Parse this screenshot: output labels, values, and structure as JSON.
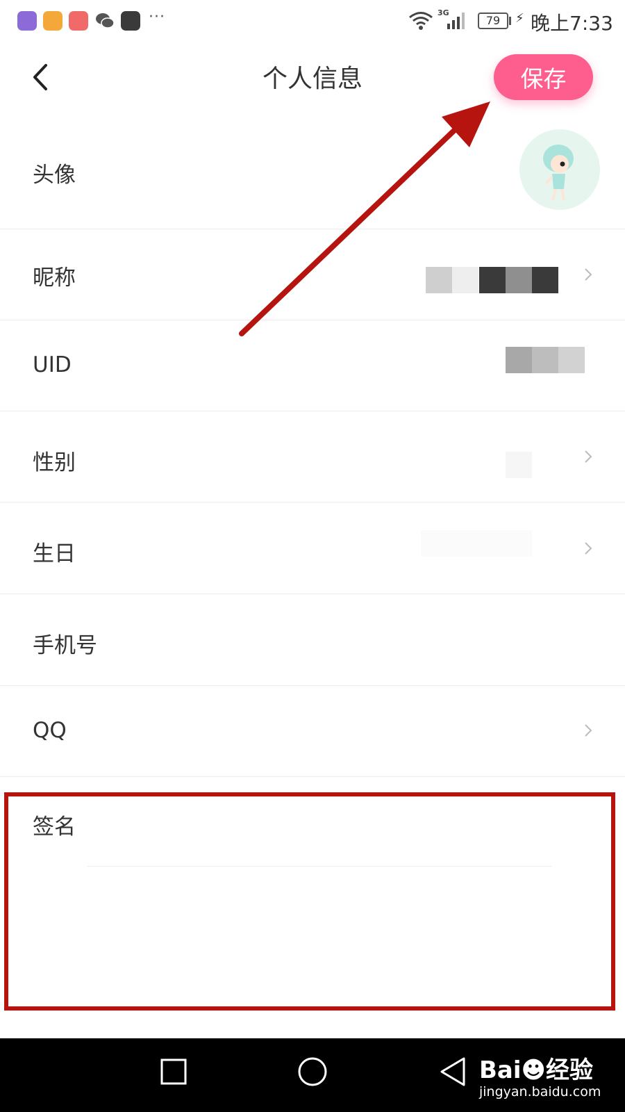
{
  "status_bar": {
    "app_icons": [
      {
        "name": "app-icon-1",
        "color": "#8c6ad8"
      },
      {
        "name": "app-icon-2",
        "color": "#f5a83a"
      },
      {
        "name": "app-icon-3",
        "color": "#f06a6a"
      },
      {
        "name": "wechat-icon",
        "color": "#555555"
      },
      {
        "name": "huawei-store-icon",
        "color": "#3a3a3a"
      }
    ],
    "more": "···",
    "network": "3G",
    "battery": "79",
    "time": "晚上7:33"
  },
  "header": {
    "title": "个人信息",
    "save_label": "保存"
  },
  "rows": [
    {
      "label": "头像",
      "has_chevron": false
    },
    {
      "label": "昵称",
      "has_chevron": true
    },
    {
      "label": "UID",
      "has_chevron": false
    },
    {
      "label": "性别",
      "has_chevron": true
    },
    {
      "label": "生日",
      "has_chevron": true
    },
    {
      "label": "手机号",
      "has_chevron": false
    },
    {
      "label": "QQ",
      "has_chevron": true
    }
  ],
  "signature": {
    "label": "签名"
  },
  "colors": {
    "accent": "#fd5e8e",
    "annotation": "#b5140f"
  },
  "watermark": {
    "logo": "Bai☻经验",
    "url": "jingyan.baidu.com"
  }
}
